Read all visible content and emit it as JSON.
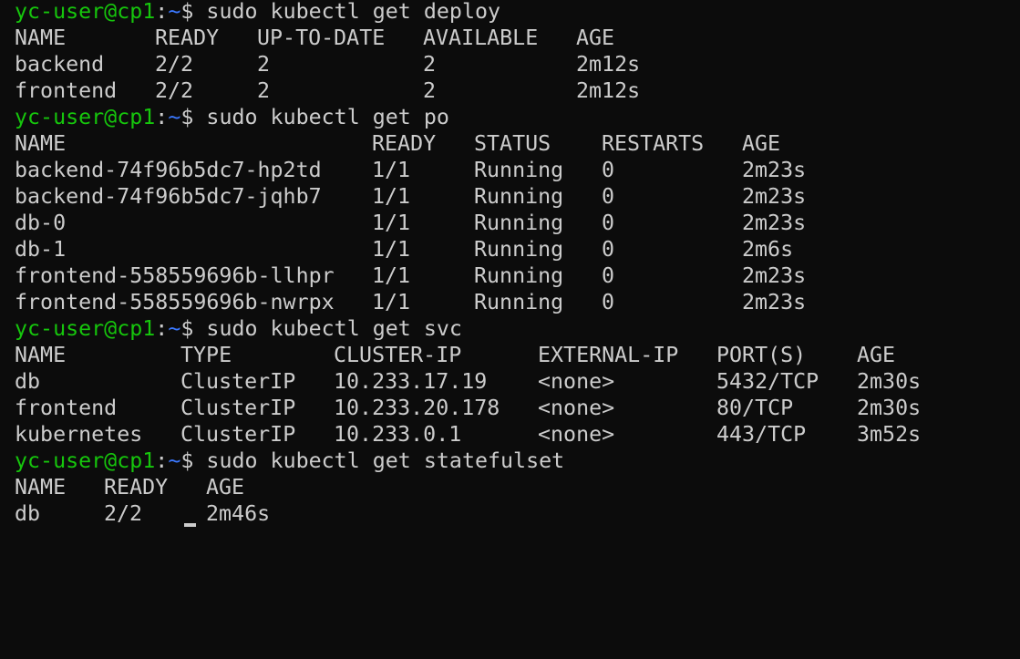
{
  "prompt": {
    "user": "yc-user@cp1",
    "colon": ":",
    "path": "~",
    "symbol": "$"
  },
  "commands": [
    "sudo kubectl get deploy",
    "sudo kubectl get po",
    "sudo kubectl get svc",
    "sudo kubectl get statefulset"
  ],
  "deploy": {
    "headers": [
      "NAME",
      "READY",
      "UP-TO-DATE",
      "AVAILABLE",
      "AGE"
    ],
    "rows": [
      [
        "backend",
        "2/2",
        "2",
        "2",
        "2m12s"
      ],
      [
        "frontend",
        "2/2",
        "2",
        "2",
        "2m12s"
      ]
    ]
  },
  "pods": {
    "headers": [
      "NAME",
      "READY",
      "STATUS",
      "RESTARTS",
      "AGE"
    ],
    "rows": [
      [
        "backend-74f96b5dc7-hp2td",
        "1/1",
        "Running",
        "0",
        "2m23s"
      ],
      [
        "backend-74f96b5dc7-jqhb7",
        "1/1",
        "Running",
        "0",
        "2m23s"
      ],
      [
        "db-0",
        "1/1",
        "Running",
        "0",
        "2m23s"
      ],
      [
        "db-1",
        "1/1",
        "Running",
        "0",
        "2m6s"
      ],
      [
        "frontend-558559696b-llhpr",
        "1/1",
        "Running",
        "0",
        "2m23s"
      ],
      [
        "frontend-558559696b-nwrpx",
        "1/1",
        "Running",
        "0",
        "2m23s"
      ]
    ]
  },
  "services": {
    "headers": [
      "NAME",
      "TYPE",
      "CLUSTER-IP",
      "EXTERNAL-IP",
      "PORT(S)",
      "AGE"
    ],
    "rows": [
      [
        "db",
        "ClusterIP",
        "10.233.17.19",
        "<none>",
        "5432/TCP",
        "2m30s"
      ],
      [
        "frontend",
        "ClusterIP",
        "10.233.20.178",
        "<none>",
        "80/TCP",
        "2m30s"
      ],
      [
        "kubernetes",
        "ClusterIP",
        "10.233.0.1",
        "<none>",
        "443/TCP",
        "3m52s"
      ]
    ]
  },
  "statefulset": {
    "headers": [
      "NAME",
      "READY",
      "AGE"
    ],
    "rows": [
      [
        "db",
        "2/2",
        "2m46s"
      ]
    ]
  }
}
